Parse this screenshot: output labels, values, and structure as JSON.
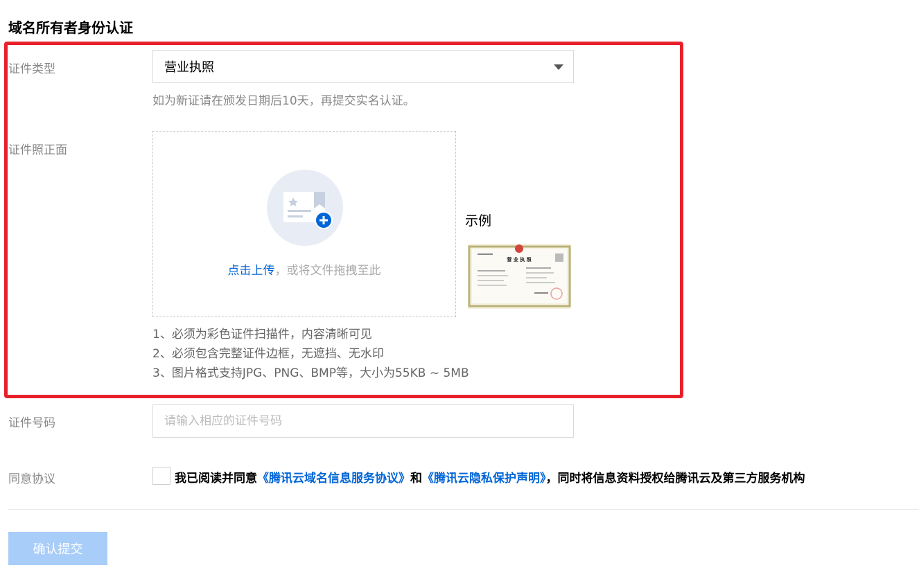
{
  "section_title": "域名所有者身份认证",
  "cert_type": {
    "label": "证件类型",
    "selected": "营业执照",
    "hint": "如为新证请在颁发日期后10天，再提交实名认证。"
  },
  "cert_front": {
    "label": "证件照正面",
    "upload_link": "点击上传",
    "upload_rest": "，或将文件拖拽至此",
    "example_label": "示例",
    "example_image": {
      "title": "营 业 执 照"
    },
    "requirements": [
      "1、必须为彩色证件扫描件，内容清晰可见",
      "2、必须包含完整证件边框，无遮挡、无水印",
      "3、图片格式支持JPG、PNG、BMP等，大小为55KB ~ 5MB"
    ]
  },
  "cert_number": {
    "label": "证件号码",
    "placeholder": "请输入相应的证件号码",
    "value": ""
  },
  "agreement": {
    "label": "同意协议",
    "text_1": "我已阅读并同意",
    "link_1": "《腾讯云域名信息服务协议》",
    "text_2": "和",
    "link_2": "《腾讯云隐私保护声明》",
    "text_3": "，同时将信息资料授权给腾讯云及第三方服务机构"
  },
  "submit_label": "确认提交",
  "colors": {
    "highlight": "#e8202b",
    "link": "#0065d7",
    "submit_disabled": "#a8cdf9"
  }
}
